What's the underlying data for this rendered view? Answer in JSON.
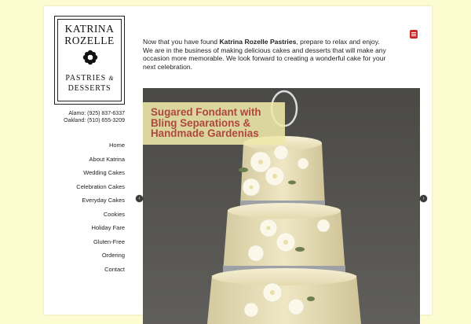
{
  "logo": {
    "name_line1": "KATRINA",
    "name_line2": "ROZELLE",
    "sub_line1": "PASTRIES",
    "sub_amp": "&",
    "sub_line2": "DESSERTS"
  },
  "phones": [
    "Alamo: (925) 837-6337",
    "Oakland: (510) 655-3209"
  ],
  "nav": [
    "Home",
    "About Katrina",
    "Wedding Cakes",
    "Celebration Cakes",
    "Everyday Cakes",
    "Cookies",
    "Holiday Fare",
    "Gluten-Free",
    "Ordering",
    "Contact"
  ],
  "intro": {
    "line1_before": "Now that you have found",
    "line1_bold": "Katrina Rozelle Pastries",
    "line1_after": ", prepare to relax and enjoy.",
    "line2": "We are in the business of making delicious cakes and desserts that will make any occasion more memorable. We look forward to creating a wonderful cake for your next celebration."
  },
  "slider": {
    "caption": "Sugared Fondant with Bling Separations & Handmade Gardenias",
    "prev_arrow": "‹",
    "next_arrow": "›"
  },
  "icons": {
    "menu": "menu-icon",
    "flower": "flower-icon"
  },
  "colors": {
    "background": "#fdfbd0",
    "caption_text": "#b0473f",
    "caption_bg": "#efe8aa",
    "menu_icon": "#cc2a2a"
  }
}
